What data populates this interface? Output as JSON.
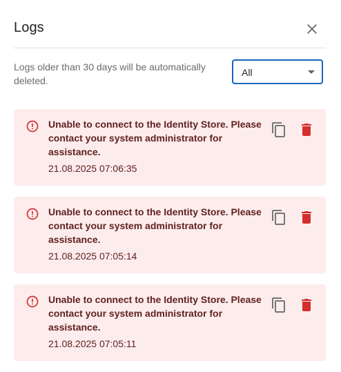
{
  "dialog": {
    "title": "Logs",
    "close_icon": "close-icon"
  },
  "filter": {
    "info_text": "Logs older than 30 days will be automatically deleted.",
    "select_value": "All"
  },
  "colors": {
    "error_bg": "#fdecec",
    "error_icon": "#d32f2f",
    "error_text": "#5f2120",
    "select_border": "#1565c0"
  },
  "logs": [
    {
      "message": "Unable to connect to the Identity Store. Please contact your system administrator for assistance.",
      "timestamp": "21.08.2025 07:06:35",
      "icon": "error-outline-icon"
    },
    {
      "message": "Unable to connect to the Identity Store. Please contact your system administrator for assistance.",
      "timestamp": "21.08.2025 07:05:14",
      "icon": "error-outline-icon"
    },
    {
      "message": "Unable to connect to the Identity Store. Please contact your system administrator for assistance.",
      "timestamp": "21.08.2025 07:05:11",
      "icon": "error-outline-icon"
    }
  ]
}
